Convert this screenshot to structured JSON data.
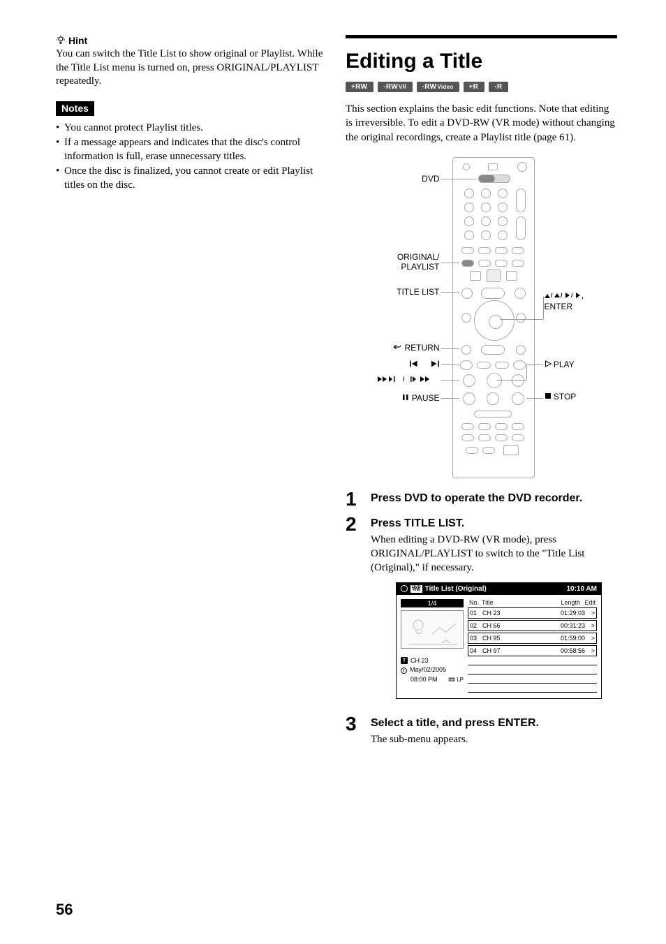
{
  "page_number": "56",
  "left": {
    "hint_label": "Hint",
    "hint_body": "You can switch the Title List to show original or Playlist. While the Title List menu is turned on, press ORIGINAL/PLAYLIST repeatedly.",
    "notes_label": "Notes",
    "notes": [
      "You cannot protect Playlist titles.",
      "If a message appears and indicates that the disc's control information is full, erase unnecessary titles.",
      "Once the disc is finalized, you cannot create or edit Playlist titles on the disc."
    ]
  },
  "right": {
    "title": "Editing a Title",
    "disc_chips": [
      {
        "main": "+RW",
        "sub": ""
      },
      {
        "main": "-RW",
        "sub": "VR"
      },
      {
        "main": "-RW",
        "sub": "Video"
      },
      {
        "main": "+R",
        "sub": ""
      },
      {
        "main": "-R",
        "sub": ""
      }
    ],
    "intro": "This section explains the basic edit functions. Note that editing is irreversible. To edit a DVD-RW (VR mode) without changing the original recordings, create a Playlist title (page 61).",
    "remote_labels": {
      "dvd": "DVD",
      "orig_playlist_1": "ORIGINAL/",
      "orig_playlist_2": "PLAYLIST",
      "title_list": "TITLE LIST",
      "return": "RETURN",
      "prev_next": "./>",
      "scan_slow": "",
      "pause": "PAUSE",
      "arrows_enter_1": "M/m/</,,",
      "arrows_enter_2": "ENTER",
      "play": "PLAY",
      "stop": "STOP"
    },
    "steps": [
      {
        "num": "1",
        "head": "Press DVD to operate the DVD recorder.",
        "text": ""
      },
      {
        "num": "2",
        "head": "Press TITLE LIST.",
        "text": "When editing a DVD-RW (VR mode), press ORIGINAL/PLAYLIST to switch to the \"Title List (Original),\" if necessary."
      },
      {
        "num": "3",
        "head": "Select a title, and press ENTER.",
        "text": "The sub-menu appears."
      }
    ],
    "title_list": {
      "disc_badge_top": "DVD",
      "disc_badge_bot": "-RW",
      "header_title": "Title List (Original)",
      "clock": "10:10 AM",
      "count": "1/4",
      "cols": {
        "no": "No.",
        "title": "Title",
        "length": "Length",
        "edit": "Edit"
      },
      "rows": [
        {
          "no": "01",
          "title": "CH 23",
          "length": "01:29:03",
          "edit": ">"
        },
        {
          "no": "02",
          "title": "CH 66",
          "length": "00:31:23",
          "edit": ">"
        },
        {
          "no": "03",
          "title": "CH 95",
          "length": "01:59:00",
          "edit": ">"
        },
        {
          "no": "04",
          "title": "CH 97",
          "length": "00:58:56",
          "edit": ">"
        }
      ],
      "meta": {
        "channel": "CH 23",
        "date": "May/02/2005",
        "time": "08:00  PM",
        "mode": "LP"
      }
    }
  }
}
